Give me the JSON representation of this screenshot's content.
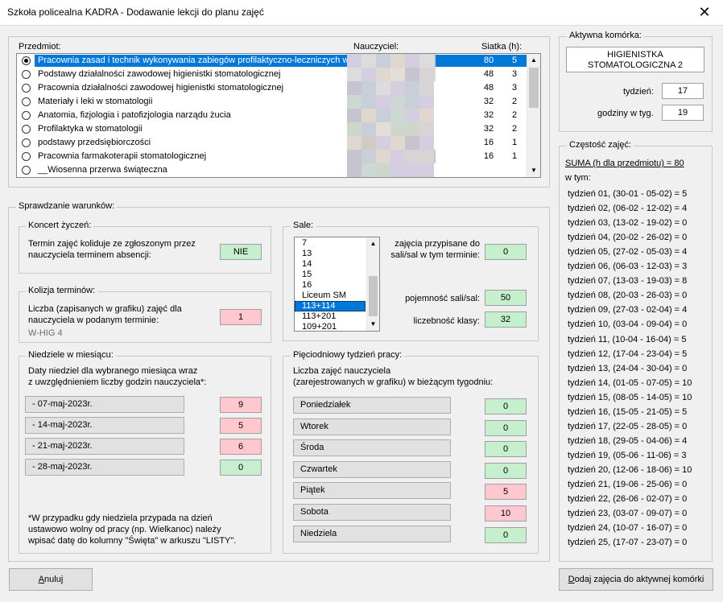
{
  "window": {
    "title": "Szkoła policealna KADRA - Dodawanie lekcji do planu zajęć",
    "close_glyph": "✕"
  },
  "subjects": {
    "header_subject": "Przedmiot:",
    "header_teacher": "Nauczyciel:",
    "header_grid": "Siatka (h):",
    "rows": [
      {
        "name": "Pracownia zasad i technik wykonywania zabiegów profilaktyczno-leczniczych w",
        "hours": "80",
        "weekly": "5",
        "selected": true
      },
      {
        "name": "Podstawy działalności zawodowej higienistki stomatologicznej",
        "hours": "48",
        "weekly": "3",
        "selected": false
      },
      {
        "name": "Pracownia działalności zawodowej higienistki stomatologicznej",
        "hours": "48",
        "weekly": "3",
        "selected": false
      },
      {
        "name": "Materiały i leki w stomatologii",
        "hours": "32",
        "weekly": "2",
        "selected": false
      },
      {
        "name": "Anatomia, fizjologia i patofizjologia narządu żucia",
        "hours": "32",
        "weekly": "2",
        "selected": false
      },
      {
        "name": "Profilaktyka w stomatologii",
        "hours": "32",
        "weekly": "2",
        "selected": false
      },
      {
        "name": "podstawy przedsiębiorczości",
        "hours": "16",
        "weekly": "1",
        "selected": false
      },
      {
        "name": "Pracownia farmakoterapii stomatologicznej",
        "hours": "16",
        "weekly": "1",
        "selected": false
      },
      {
        "name": "__Wiosenna przerwa świąteczna",
        "hours": "",
        "weekly": "",
        "selected": false
      }
    ]
  },
  "active_cell": {
    "title": "Aktywna komórka:",
    "value_line1": "HIGIENISTKA",
    "value_line2": "STOMATOLOGICZNA 2",
    "week_label": "tydzień:",
    "week_value": "17",
    "hours_label": "godziny w tyg.",
    "hours_value": "19"
  },
  "frequency": {
    "title": "Częstość zajęć:",
    "sum_line": "SUMA (h dla przedmiotu) = 80",
    "in_that": "w tym:",
    "weeks": [
      "tydzień 01, (30-01 - 05-02) = 5",
      "tydzień 02, (06-02 - 12-02) = 4",
      "tydzień 03, (13-02 - 19-02) = 0",
      "tydzień 04, (20-02 - 26-02) = 0",
      "tydzień 05, (27-02 - 05-03) = 4",
      "tydzień 06, (06-03 - 12-03) = 3",
      "tydzień 07, (13-03 - 19-03) = 8",
      "tydzień 08, (20-03 - 26-03) = 0",
      "tydzień 09, (27-03 - 02-04) = 4",
      "tydzień 10, (03-04 - 09-04) = 0",
      "tydzień 11, (10-04 - 16-04) = 5",
      "tydzień 12, (17-04 - 23-04) = 5",
      "tydzień 13, (24-04 - 30-04) = 0",
      "tydzień 14, (01-05 - 07-05) = 10",
      "tydzień 15, (08-05 - 14-05) = 10",
      "tydzień 16, (15-05 - 21-05) = 5",
      "tydzień 17, (22-05 - 28-05) = 0",
      "tydzień 18, (29-05 - 04-06) = 4",
      "tydzień 19, (05-06 - 11-06) = 3",
      "tydzień 20, (12-06 - 18-06) = 10",
      "tydzień 21, (19-06 - 25-06) = 0",
      "tydzień 22, (26-06 - 02-07) = 0",
      "tydzień 23, (03-07 - 09-07) = 0",
      "tydzień 24, (10-07 - 16-07) = 0",
      "tydzień 25, (17-07 - 23-07) = 0"
    ]
  },
  "checks": {
    "title": "Sprawdzanie warunków:",
    "wishes": {
      "title": "Koncert życzeń:",
      "line1": "Termin zajęć koliduje ze zgłoszonym przez",
      "line2": "nauczyciela terminem absencji:",
      "value": "NIE"
    },
    "collision": {
      "title": "Kolizja terminów:",
      "line1": "Liczba (zapisanych w grafiku) zajęć dla",
      "line2": "nauczyciela w podanym terminie:",
      "value": "1",
      "note": "W-HIG 4"
    },
    "sundays": {
      "title": "Niedziele w miesiącu:",
      "line1": "Daty niedziel dla wybranego miesiąca wraz",
      "line2": "z uwzględnieniem liczby godzin nauczyciela*:",
      "items": [
        {
          "date": " - 07-maj-2023r.",
          "value": "9"
        },
        {
          "date": " - 14-maj-2023r.",
          "value": "5"
        },
        {
          "date": " - 21-maj-2023r.",
          "value": "6"
        },
        {
          "date": " - 28-maj-2023r.",
          "value": "0"
        }
      ],
      "footnote1": "*W przypadku gdy niedziela przypada na dzień",
      "footnote2": "ustawowo wolny od pracy (np. Wielkanoc) należy",
      "footnote3": "wpisać datę do kolumny \"Święta\" w arkuszu \"LISTY\"."
    },
    "rooms": {
      "title": "Sale:",
      "items": [
        "7",
        "13",
        "14",
        "15",
        "16",
        "Liceum SM",
        "113+114",
        "113+201",
        "109+201"
      ],
      "selected_index": 6,
      "assigned_line1": "zajęcia przypisane do",
      "assigned_line2": "sali/sal w tym terminie:",
      "assigned_value": "0",
      "capacity_label": "pojemność sali/sal:",
      "capacity_value": "50",
      "class_size_label": "liczebność klasy:",
      "class_size_value": "32"
    },
    "week": {
      "title": "Pięciodniowy tydzień pracy:",
      "line1": "Liczba zajęć nauczyciela",
      "line2": "(zarejestrowanych w grafiku) w bieżącym tygodniu:",
      "days": [
        {
          "name": "Poniedziałek",
          "value": "0"
        },
        {
          "name": "Wtorek",
          "value": "0"
        },
        {
          "name": "Środa",
          "value": "0"
        },
        {
          "name": "Czwartek",
          "value": "0"
        },
        {
          "name": "Piątek",
          "value": "5"
        },
        {
          "name": "Sobota",
          "value": "10"
        },
        {
          "name": "Niedziela",
          "value": "0"
        }
      ]
    }
  },
  "buttons": {
    "cancel_prefix": "A",
    "cancel_rest": "nuluj",
    "add_prefix": "D",
    "add_rest": "odaj zajęcia do aktywnej komórki"
  },
  "colors": {
    "ok": "#c6efce",
    "bad": "#ffc7ce",
    "selection": "#0078d7"
  }
}
